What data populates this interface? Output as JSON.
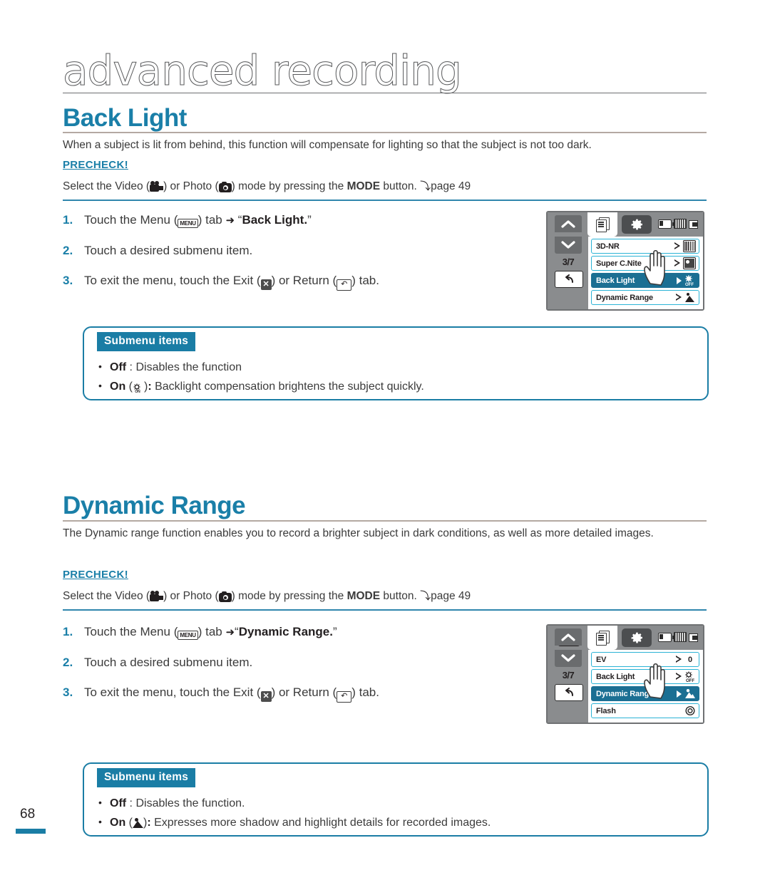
{
  "page": {
    "chapter_title": "advanced recording",
    "page_number": "68"
  },
  "sections": [
    {
      "heading": "Back Light",
      "intro": "When a subject is lit from behind, this function will compensate for lighting so that the subject is not too dark.",
      "precheck_label": "PRECHECK!",
      "precheck_text_before": "Select the Video (",
      "precheck_text_mid": ") or Photo (",
      "precheck_text_after": ") mode by pressing the ",
      "precheck_mode": "MODE",
      "precheck_tail": " button. ",
      "precheck_page": "page 49",
      "steps": [
        {
          "num": "1.",
          "pre": "Touch the Menu (",
          "chip": "MENU",
          "mid": ") tab ",
          "arrow": "➜",
          "post": " “",
          "bold": "Back Light.",
          "tail": "”"
        },
        {
          "num": "2.",
          "text": "Touch a desired submenu item."
        },
        {
          "num": "3.",
          "pre": "To exit the menu, touch the Exit (",
          "mid": ") or Return (",
          "tail": ") tab."
        }
      ],
      "submenu": {
        "badge": "Submenu items",
        "items": [
          {
            "bold": "Off",
            "sep": " : ",
            "text": "Disables the function"
          },
          {
            "bold": "On",
            "icon": "backlight-on-icon",
            "sep": ": ",
            "text": "Backlight compensation brightens the subject quickly."
          }
        ]
      },
      "lcd": {
        "mode_icon": "video-camera-icon",
        "menu_tab_icon": "menu-pages-icon",
        "settings_tab_icon": "gear-icon",
        "indicators": [
          "battery-icon",
          "tape-icon",
          "card-icon"
        ],
        "up_arrow": "⌃",
        "down_arrow": "⌄",
        "page_indicator": "3/7",
        "return_icon": "↶",
        "rows": [
          {
            "label": "3D-NR",
            "icon": "3dnr-icon",
            "selected": false
          },
          {
            "label": "Super C.Nite",
            "icon": "cnite-icon",
            "selected": false
          },
          {
            "label": "Back Light",
            "icon": "backlight-off-icon",
            "selected": true
          },
          {
            "label": "Dynamic Range",
            "icon": "dynamic-range-icon",
            "selected": false
          }
        ]
      }
    },
    {
      "heading": "Dynamic Range",
      "intro": "The Dynamic range function enables you to record a brighter subject in dark conditions, as well as more detailed images.",
      "precheck_label": "PRECHECK!",
      "precheck_text_before": "Select the Video (",
      "precheck_text_mid": ") or Photo (",
      "precheck_text_after": ") mode by pressing the ",
      "precheck_mode": "MODE",
      "precheck_tail": " button. ",
      "precheck_page": "page 49",
      "steps": [
        {
          "num": "1.",
          "pre": "Touch the Menu (",
          "chip": "MENU",
          "mid": ") tab ",
          "arrow": "➜",
          "post": "“",
          "bold": "Dynamic Range.",
          "tail": "”"
        },
        {
          "num": "2.",
          "text": "Touch a desired submenu item."
        },
        {
          "num": "3.",
          "pre": "To exit the menu, touch the Exit (",
          "mid": ") or Return (",
          "tail": ") tab."
        }
      ],
      "submenu": {
        "badge": "Submenu items",
        "items": [
          {
            "bold": "Off",
            "sep": " : ",
            "text": "Disables the function."
          },
          {
            "bold": "On",
            "icon": "dynamic-range-icon",
            "sep": ": ",
            "text": "Expresses more shadow and highlight details for recorded images."
          }
        ]
      },
      "lcd": {
        "mode_icon": "photo-camera-icon",
        "menu_tab_icon": "menu-pages-icon",
        "settings_tab_icon": "gear-icon",
        "indicators": [
          "battery-icon",
          "tape-icon",
          "card-icon"
        ],
        "up_arrow": "⌃",
        "down_arrow": "⌄",
        "page_indicator": "3/7",
        "return_icon": "↶",
        "rows": [
          {
            "label": "EV",
            "icon": "ev-value",
            "value": "0",
            "selected": false
          },
          {
            "label": "Back Light",
            "icon": "backlight-off-icon",
            "selected": false
          },
          {
            "label": "Dynamic Range",
            "icon": "dynamic-range-icon",
            "selected": true
          },
          {
            "label": "Flash",
            "icon": "flash-icon",
            "selected": false
          }
        ]
      }
    }
  ],
  "colors": {
    "accent": "#1a7fa8",
    "badge": "#1a7da5",
    "row_selected": "#1b6f93",
    "row_border": "#2bb3d6",
    "rule": "#b4a9a2"
  }
}
